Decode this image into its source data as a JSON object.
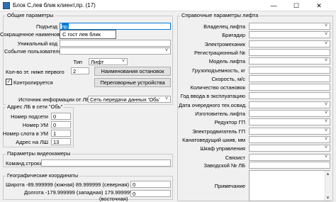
{
  "window": {
    "title": "Блок С,лев блик клиент,пр. (17)",
    "minimize": "—",
    "maximize": "☐",
    "close": "✕"
  },
  "general": {
    "title": "Общие параметры",
    "entrance_label": "Подъезд",
    "entrance_value": "пр.",
    "entrance_option": "С гост лев блик",
    "short_name_label": "Сокращенное наименован.",
    "unique_code_label": "Уникальный код",
    "user_event_label": "Событие пользователя",
    "type_label": "Тип",
    "type_value": "Лифт",
    "stops_below_label": "Кол-во эт. ниже первого",
    "stops_below_value": "2",
    "stop_names_button": "Наименования остановок",
    "controlled_label": "Контролируется",
    "controlled_checked": "✓",
    "negotiation_button": "Переговорные устройства",
    "source_label": "Источник информации от ЛБ",
    "source_value": "Сеть передачи данных 'Обь'"
  },
  "lb_address": {
    "title": "Адрес ЛБ в сети \"Обь\"",
    "subnet_label": "Номер подсети",
    "subnet_value": "0",
    "um_label": "Номер УМ",
    "um_value": "0",
    "um_slot_label": "Номер слота в УМ",
    "um_slot_value": "1",
    "lsh_label": "Адрес на ЛШ",
    "lsh_value": "13"
  },
  "video": {
    "title": "Параметры видеокамеры",
    "command_label": "Команд.строка"
  },
  "geo": {
    "title": "Географические координаты",
    "lat_label": "Широта -89.999999 (южная) 89.999999 (северная)",
    "lat_value": "0",
    "lon_label_1": "Долгота -179.999999 (западная) 179.999999",
    "lon_label_2": "(восточная)",
    "lon_value": "0"
  },
  "reference": {
    "title": "Справочные параметры лифта",
    "fields": [
      {
        "label": "Владелец лифта",
        "type": "dropdown"
      },
      {
        "label": "Бригадир",
        "type": "dropdown"
      },
      {
        "label": "Электромеханик",
        "type": "dropdown"
      },
      {
        "label": "Регистрационный №",
        "type": "text"
      },
      {
        "label": "Модель лифта",
        "type": "dropdown"
      },
      {
        "label": "Грузоподъемность, кг",
        "type": "text"
      },
      {
        "label": "Скорость, м/с",
        "type": "text"
      },
      {
        "label": "Количество остановок",
        "type": "text"
      },
      {
        "label": "Год ввода в эксплуатацию",
        "type": "text"
      },
      {
        "label": "Дата очередного тех.освид.",
        "type": "dropdown"
      },
      {
        "label": "Изготовитель лифта",
        "type": "dropdown"
      },
      {
        "label": "Редуктор ГП",
        "type": "dropdown"
      },
      {
        "label": "Электродвигатель ГП",
        "type": "dropdown"
      },
      {
        "label": "Канатоведущий шкив, мм",
        "type": "dropdown"
      },
      {
        "label": "Шкаф управления",
        "type": "dropdown"
      },
      {
        "label": "Связист",
        "type": "dropdown"
      }
    ],
    "factory_number_label": "Заводской № ЛБ",
    "note_label": "Примечание"
  }
}
